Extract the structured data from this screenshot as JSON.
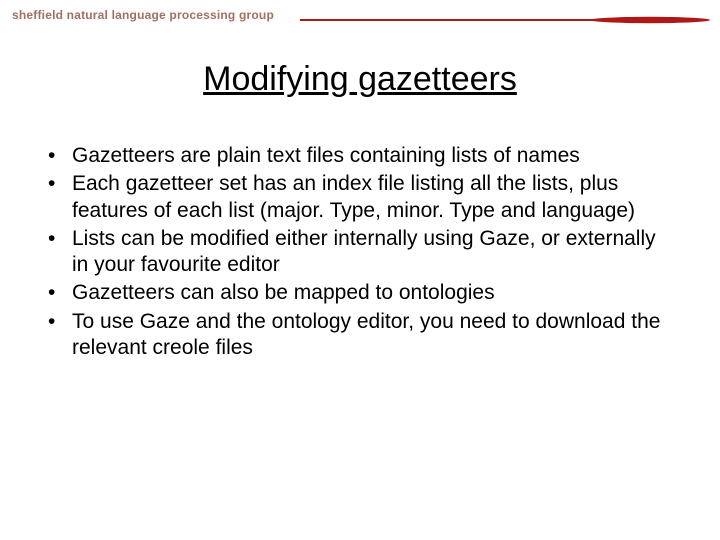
{
  "header": {
    "group_label": "sheffield natural language processing group"
  },
  "slide": {
    "title": "Modifying gazetteers",
    "bullets": [
      "Gazetteers are plain text files containing lists of names",
      "Each gazetteer set has an index file listing all the lists, plus features of each list (major. Type, minor. Type and language)",
      "Lists can be modified either internally using Gaze, or externally in your favourite editor",
      "Gazetteers can also be mapped to ontologies",
      "To use Gaze and the ontology editor, you need to download the relevant creole files"
    ]
  }
}
